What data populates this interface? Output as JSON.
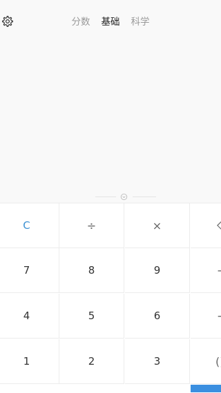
{
  "header": {
    "settings_icon": "gear-icon",
    "tabs": [
      {
        "label": "分数",
        "active": false
      },
      {
        "label": "基础",
        "active": true
      },
      {
        "label": "科学",
        "active": false
      }
    ]
  },
  "display": {
    "expression": "",
    "result": ""
  },
  "keypad": {
    "rows": [
      [
        "C",
        "÷",
        "×",
        "⌫"
      ],
      [
        "7",
        "8",
        "9",
        "−"
      ],
      [
        "4",
        "5",
        "6",
        "+"
      ],
      [
        "1",
        "2",
        "3",
        "()"
      ]
    ]
  },
  "colors": {
    "accent": "#3e92d3",
    "equals": "#3b8fe0"
  }
}
